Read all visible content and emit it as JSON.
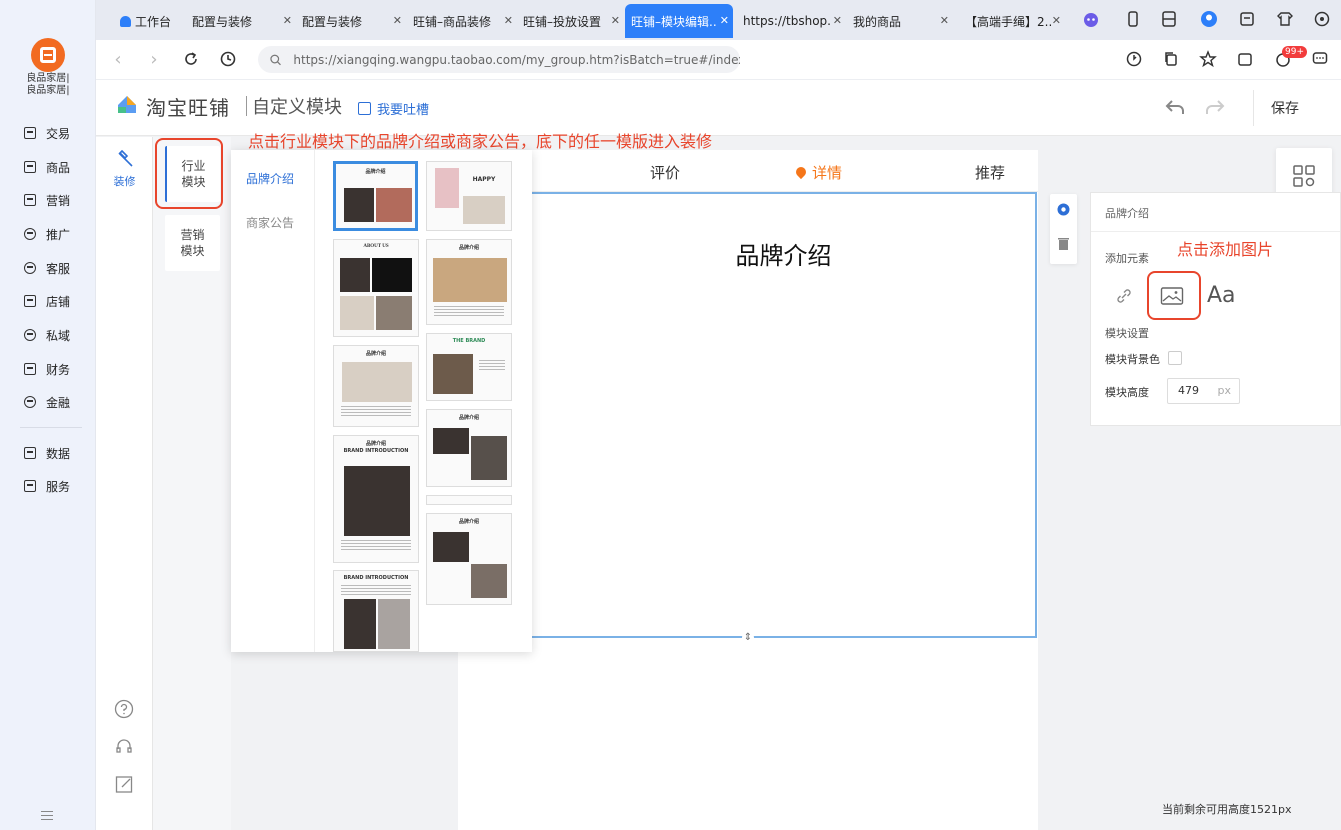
{
  "sidebar": {
    "app_name": "良品家居|\n良品家居|",
    "items": [
      {
        "label": "交易",
        "icon": "receipt-icon"
      },
      {
        "label": "商品",
        "icon": "goods-icon"
      },
      {
        "label": "营销",
        "icon": "ticket-icon"
      },
      {
        "label": "推广",
        "icon": "send-icon"
      },
      {
        "label": "客服",
        "icon": "headset-icon"
      },
      {
        "label": "店铺",
        "icon": "shop-icon"
      },
      {
        "label": "私域",
        "icon": "people-icon"
      },
      {
        "label": "财务",
        "icon": "money-icon"
      },
      {
        "label": "金融",
        "icon": "finance-icon"
      },
      {
        "label": "数据",
        "icon": "chart-icon"
      },
      {
        "label": "服务",
        "icon": "service-icon"
      }
    ]
  },
  "tabs": [
    {
      "label": "工作台"
    },
    {
      "label": "配置与装修"
    },
    {
      "label": "配置与装修"
    },
    {
      "label": "旺铺–商品装修"
    },
    {
      "label": "旺铺–投放设置"
    },
    {
      "label": "旺铺–模块编辑..."
    },
    {
      "label": "https://tbshop...."
    },
    {
      "label": "我的商品"
    },
    {
      "label": "【高端手绳】2..."
    }
  ],
  "address_bar": {
    "url": "https://xiangqing.wangpu.taobao.com/my_group.htm?isBatch=true#/index?...",
    "badge": "99+"
  },
  "header": {
    "brand": "淘宝旺铺",
    "title": "自定义模块",
    "feedback": "我要吐槽",
    "save": "保存"
  },
  "tools": {
    "decorate": "装修"
  },
  "categories": [
    {
      "label": "行业\n模块"
    },
    {
      "label": "营销\n模块"
    }
  ],
  "template_popup": {
    "sub_tabs": [
      "品牌介绍",
      "商家公告"
    ],
    "thumb_captions": [
      "品牌介绍",
      "HAPPY",
      "ABOUT US",
      "品牌介绍",
      "品牌介绍",
      "THE BRAND",
      "品牌介绍",
      "品牌介绍",
      "BRAND INTRODUCTION",
      "品牌介绍",
      "BRAND INTRODUCTION"
    ]
  },
  "canvas": {
    "tabs": [
      "评价",
      "详情",
      "推荐"
    ],
    "module_title": "品牌介绍"
  },
  "props": {
    "title": "品牌介绍",
    "add_element": "添加元素",
    "text_tool": "Aa",
    "module_settings": "模块设置",
    "bg_color": "模块背景色",
    "height_label": "模块高度",
    "height_value": "479",
    "height_unit": "px"
  },
  "remaining_height": "当前剩余可用高度1521px",
  "annotations": {
    "instruction": "点击行业模块下的品牌介绍或商家公告，底下的任一模版进入装修",
    "add_image": "点击添加图片"
  },
  "colors": {
    "accent": "#2d7ff9",
    "annotation": "#e8452c",
    "orange": "#f5761a"
  }
}
